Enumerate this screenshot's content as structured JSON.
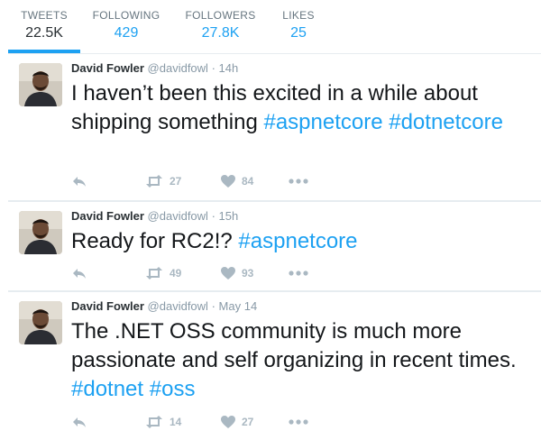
{
  "profile_nav": {
    "stats": [
      {
        "label": "TWEETS",
        "value": "22.5K",
        "active": true
      },
      {
        "label": "FOLLOWING",
        "value": "429"
      },
      {
        "label": "FOLLOWERS",
        "value": "27.8K"
      },
      {
        "label": "LIKES",
        "value": "25"
      }
    ]
  },
  "colors": {
    "accent": "#1da1f2",
    "text": "#14171a",
    "muted": "#8899a6",
    "icon": "#aab8c2",
    "separator": "#e6ecf0"
  },
  "tweets": [
    {
      "name": "David Fowler",
      "handle": "@davidfowl",
      "dot": "·",
      "time": "14h",
      "text": "I haven’t been this excited in a while about shipping something ",
      "hashtags": [
        "#aspnetcore",
        "#dotnetcore"
      ],
      "retweets": "27",
      "likes": "84",
      "icons": {
        "reply": "reply-icon",
        "retweet": "retweet-icon",
        "like": "heart-icon",
        "more": "more-icon"
      }
    },
    {
      "name": "David Fowler",
      "handle": "@davidfowl",
      "dot": "·",
      "time": "15h",
      "text": "Ready for RC2!? ",
      "hashtags": [
        "#aspnetcore"
      ],
      "retweets": "49",
      "likes": "93",
      "icons": {
        "reply": "reply-icon",
        "retweet": "retweet-icon",
        "like": "heart-icon",
        "more": "more-icon"
      }
    },
    {
      "name": "David Fowler",
      "handle": "@davidfowl",
      "dot": "·",
      "time": "May 14",
      "text": "The .NET OSS community is much more passionate and self organizing in recent times. ",
      "hashtags": [
        "#dotnet",
        "#oss"
      ],
      "retweets": "14",
      "likes": "27",
      "icons": {
        "reply": "reply-icon",
        "retweet": "retweet-icon",
        "like": "heart-icon",
        "more": "more-icon"
      }
    }
  ]
}
